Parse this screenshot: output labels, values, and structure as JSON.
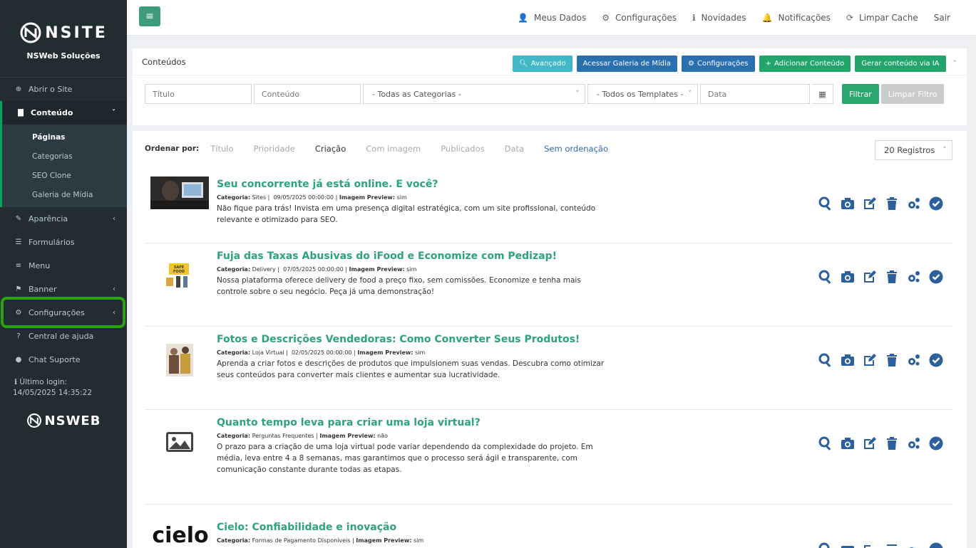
{
  "sidebar": {
    "brand_name": "NSITE",
    "brand_sub": "NSWeb Soluções",
    "items": [
      {
        "label": "Abrir o Site",
        "icon": "globe-icon"
      },
      {
        "label": "Conteúdo",
        "icon": "file-icon"
      },
      {
        "label": "Aparência",
        "icon": "brush-icon"
      },
      {
        "label": "Formulários",
        "icon": "list-icon"
      },
      {
        "label": "Menu",
        "icon": "bars-icon"
      },
      {
        "label": "Banner",
        "icon": "flag-icon"
      },
      {
        "label": "Configurações",
        "icon": "gear-icon"
      },
      {
        "label": "Central de ajuda",
        "icon": "question-icon"
      },
      {
        "label": "Chat Suporte",
        "icon": "chat-icon"
      }
    ],
    "submenu": [
      "Páginas",
      "Categorias",
      "SEO Clone",
      "Galeria de Mídia"
    ],
    "last_login_label": "Último login:",
    "last_login_value": "14/05/2025 14:35:22",
    "footer_brand": "NSWEB"
  },
  "topbar": {
    "links": [
      "Meus Dados",
      "Configurações",
      "Novidades",
      "Notificações",
      "Limpar Cache",
      "Sair"
    ]
  },
  "filters_panel": {
    "title": "Conteúdos",
    "buttons": [
      "Avançado",
      "Acessar Galeria de Mídia",
      "Configurações",
      "Adicionar Conteúdo",
      "Gerar conteúdo via IA"
    ],
    "placeholders": {
      "titulo": "Título",
      "conteudo": "Conteúdo",
      "data": "Data"
    },
    "category_select": "- Todas as Categorias -",
    "template_select": "- Todos os Templates -",
    "filter_button": "Filtrar",
    "clear_button": "Limpar Filtro"
  },
  "list": {
    "sort_label": "Ordenar por:",
    "sort_options": [
      "Título",
      "Prioridade",
      "Criação",
      "Com imagem",
      "Publicados",
      "Data",
      "Sem ordenação"
    ],
    "records_select": "20 Registros",
    "items": [
      {
        "title": "Seu concorrente já está online. E você?",
        "category": "Sites",
        "date": "09/05/2025 00:00:00",
        "preview": "sim",
        "desc": "Não fique para trás! Invista em uma presença digital estratégica, com um site profissional, conteúdo relevante e otimizado para SEO."
      },
      {
        "title": "Fuja das Taxas Abusivas do iFood e Economize com Pedizap!",
        "category": "Delivery",
        "date": "07/05/2025 00:00:00",
        "preview": "sim",
        "desc": "Nossa plataforma oferece delivery de food a preço fixo, sem comissões. Economize e tenha mais controle sobre o seu negócio. Peça já uma demonstração!"
      },
      {
        "title": "Fotos e Descrições Vendedoras: Como Converter Seus Produtos!",
        "category": "Loja Virtual",
        "date": "02/05/2025 00:00:00",
        "preview": "sim",
        "desc": "Aprenda a criar fotos e descrições de produtos que impulsionem suas vendas. Descubra como otimizar seus conteúdos para converter mais clientes e aumentar sua lucratividade."
      },
      {
        "title": "Quanto tempo leva para criar uma loja virtual?",
        "category": "Perguntas Frequentes",
        "date": "",
        "preview": "não",
        "desc": "O prazo para a criação de uma loja virtual pode variar dependendo da complexidade do projeto. Em média, leva entre 4 a 8 semanas, mas garantimos que o processo será ágil e transparente, com comunicação constante durante todas as etapas."
      },
      {
        "title": "Cielo: Confiabilidade e inovação",
        "category": "Formas de Pagamento Disponíveis",
        "date": "",
        "preview": "sim",
        "desc": ""
      }
    ],
    "meta_labels": {
      "category": "Categoria:",
      "preview": "Imagem Preview:"
    },
    "thumb_labels": {
      "cielo": "cielo",
      "safe_food": "SAFE FOOD DELIVERY"
    }
  },
  "colors": {
    "accent": "#2aa37e",
    "sidebar": "#222d32",
    "highlight": "#2aa311",
    "action_icons": "#2c5f9b"
  }
}
